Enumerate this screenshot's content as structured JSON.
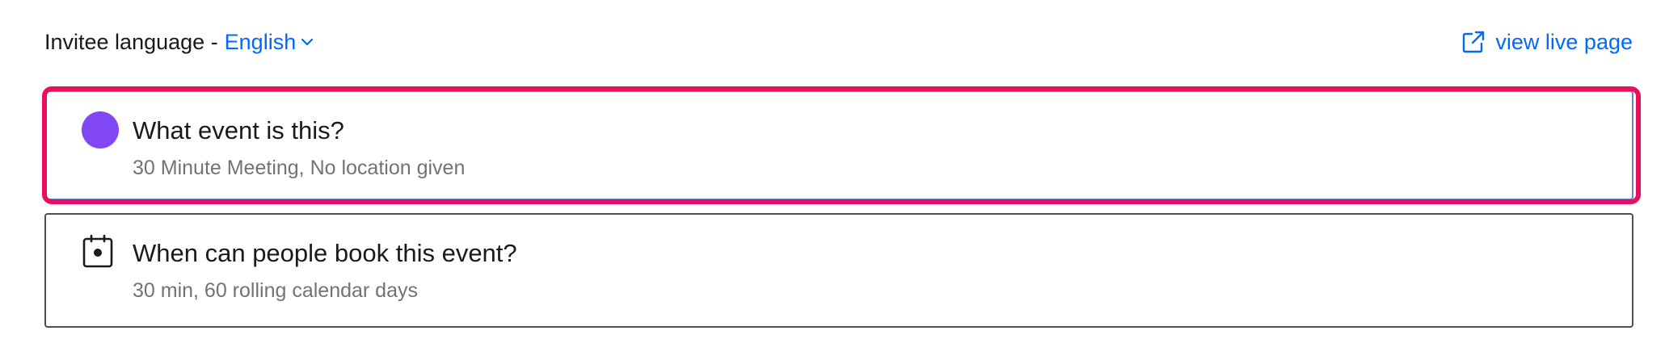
{
  "header": {
    "language_label": "Invitee language -",
    "language_value": "English",
    "view_live_label": "view live page"
  },
  "cards": [
    {
      "title": "What event is this?",
      "subtitle": "30 Minute Meeting, No location given",
      "color": "#8247f5",
      "icon": "color-dot-icon"
    },
    {
      "title": "When can people book this event?",
      "subtitle": "30 min, 60 rolling calendar days",
      "icon": "calendar-icon"
    }
  ],
  "colors": {
    "link": "#0069ff",
    "highlight": "#ea0f5e"
  }
}
